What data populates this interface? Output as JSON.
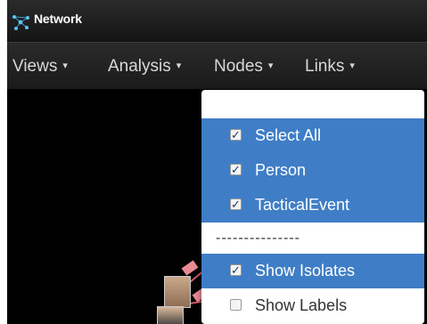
{
  "window": {
    "title": "Network",
    "logo_icon": "network-graph-icon"
  },
  "menubar": {
    "items": [
      {
        "label": "Views",
        "caret": "▾"
      },
      {
        "label": "Analysis",
        "caret": "▾"
      },
      {
        "label": "Nodes",
        "caret": "▾"
      },
      {
        "label": "Links",
        "caret": "▾"
      }
    ]
  },
  "nodes_menu": {
    "items": [
      {
        "label": "Select All",
        "checked": true,
        "mark": "✓"
      },
      {
        "label": "Person",
        "checked": true,
        "mark": "✓"
      },
      {
        "label": "TacticalEvent",
        "checked": true,
        "mark": "✓"
      },
      {
        "label": "Show Isolates",
        "checked": true,
        "mark": "✓"
      },
      {
        "label": "Show Labels",
        "checked": false,
        "mark": ""
      }
    ],
    "separator": "---------------"
  },
  "colors": {
    "accent": "#3f7ec6",
    "edge": "#d45b68",
    "background": "#000000"
  }
}
